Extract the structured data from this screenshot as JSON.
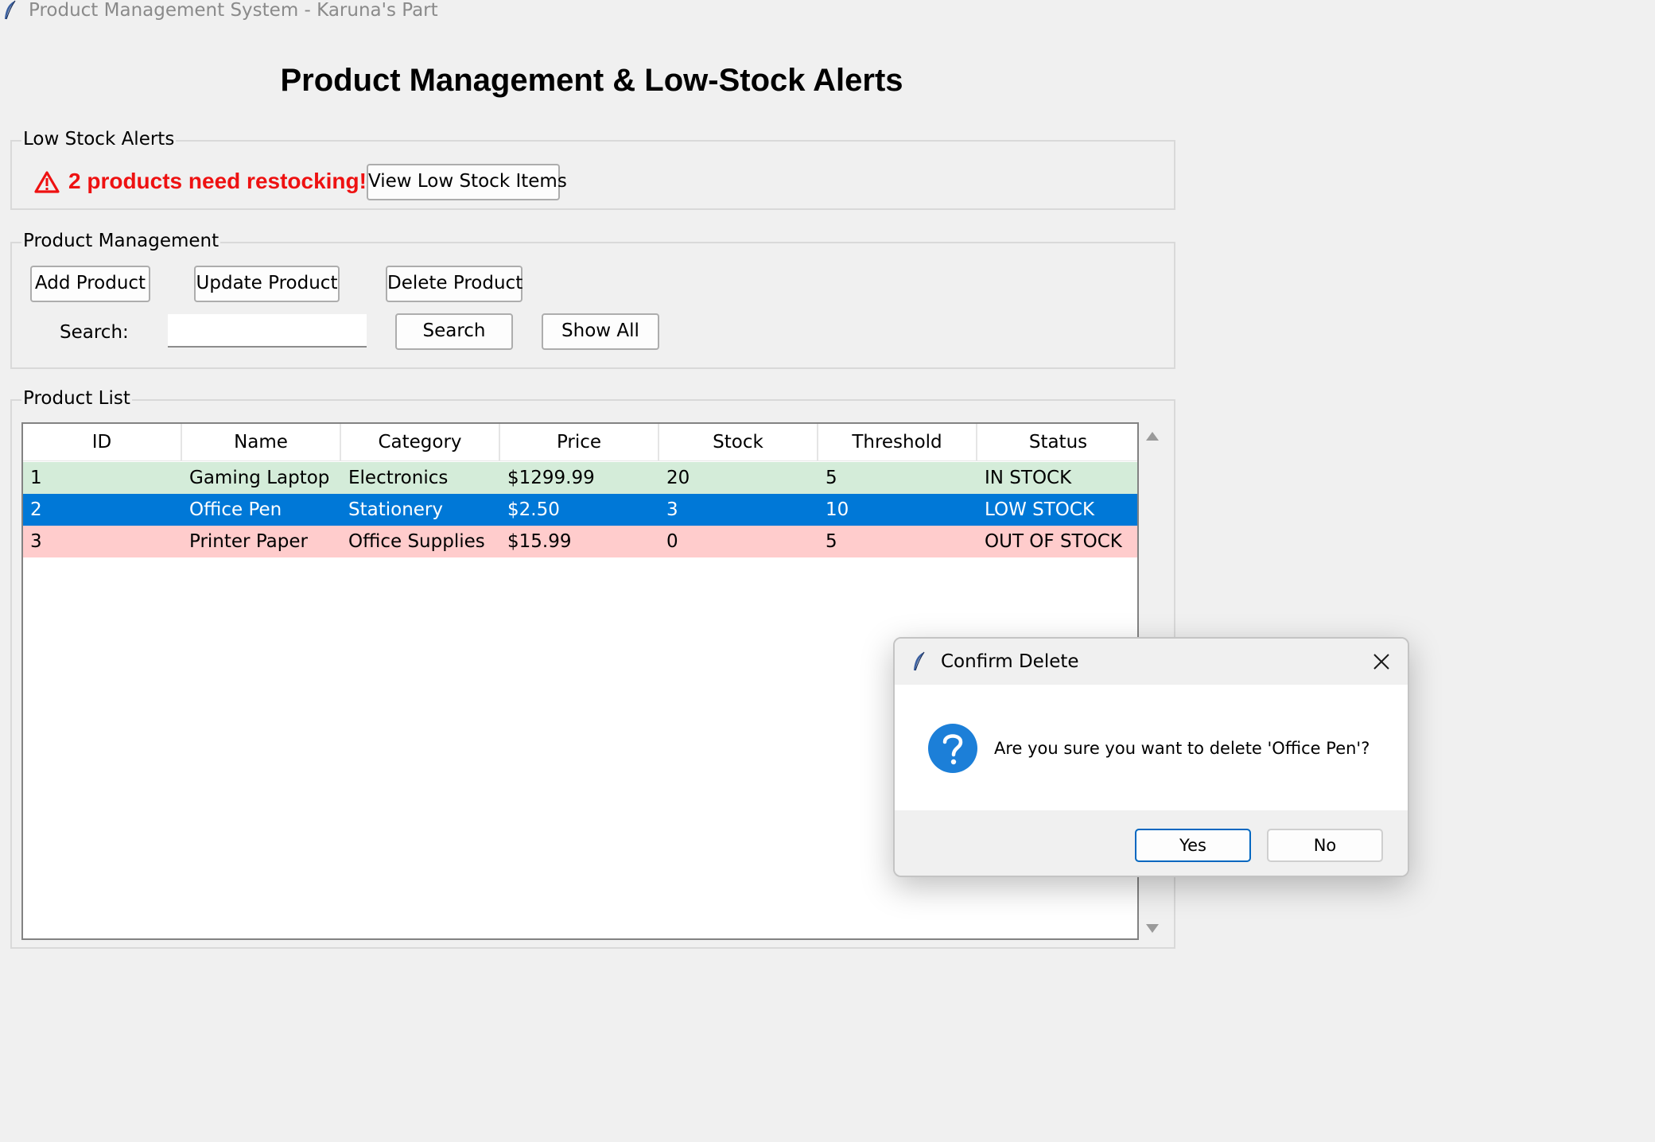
{
  "window": {
    "title": "Product Management System - Karuna's Part",
    "icon": "feather-icon"
  },
  "heading": "Product Management & Low-Stock Alerts",
  "low_stock": {
    "frame_label": "Low Stock Alerts",
    "alert_icon": "warning-icon",
    "alert_text": "2 products need restocking!",
    "view_button": "View Low Stock Items",
    "alert_color": "#ee1111"
  },
  "management": {
    "frame_label": "Product Management",
    "add_button": "Add Product",
    "update_button": "Update Product",
    "delete_button": "Delete Product",
    "search_label": "Search:",
    "search_value": "",
    "search_button": "Search",
    "show_all_button": "Show All"
  },
  "product_list": {
    "frame_label": "Product List",
    "columns": [
      "ID",
      "Name",
      "Category",
      "Price",
      "Stock",
      "Threshold",
      "Status"
    ],
    "rows": [
      {
        "cells": [
          "1",
          "Gaming Laptop",
          "Electronics",
          "$1299.99",
          "20",
          "5",
          "IN STOCK"
        ],
        "state": "in-stock"
      },
      {
        "cells": [
          "2",
          "Office Pen",
          "Stationery",
          "$2.50",
          "3",
          "10",
          "LOW STOCK"
        ],
        "state": "selected"
      },
      {
        "cells": [
          "3",
          "Printer Paper",
          "Office Supplies",
          "$15.99",
          "0",
          "5",
          "OUT OF STOCK"
        ],
        "state": "out-of-stock"
      }
    ],
    "row_colors": {
      "in-stock": "#d4ecd9",
      "selected": "#0078d7",
      "out-of-stock": "#ffcccc"
    }
  },
  "dialog": {
    "title": "Confirm Delete",
    "icon": "question-icon",
    "message": "Are you sure you want to delete 'Office Pen'?",
    "yes_button": "Yes",
    "no_button": "No",
    "close_icon": "close-icon"
  }
}
